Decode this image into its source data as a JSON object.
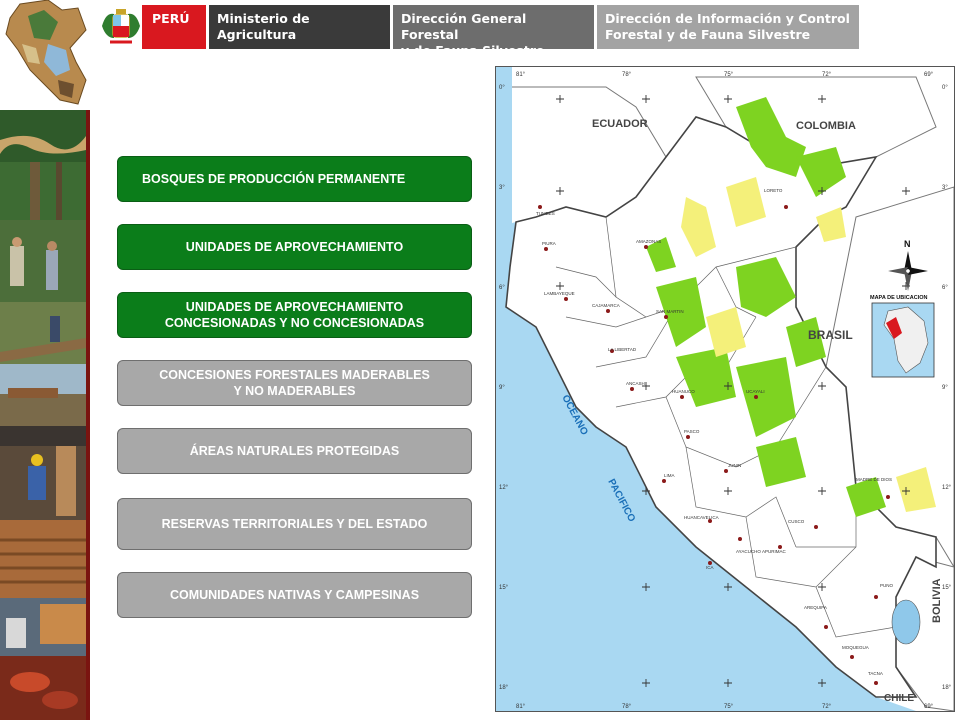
{
  "header": {
    "country": "PERÚ",
    "ministry": "Ministerio de\nAgricultura",
    "directorate": "Dirección General Forestal\ny de Fauna Silvestre",
    "office": "Dirección de Información y Control\nForestal y de Fauna Silvestre"
  },
  "colors": {
    "peru_red": "#d9181f",
    "button_green": "#0b7d1a",
    "button_gray": "#a8a8a8",
    "sea_blue": "#a9d8f2",
    "forest_green": "#7ed321",
    "forest_yellow": "#f4f07a"
  },
  "menu": [
    {
      "label": "BOSQUES DE PRODUCCIÓN PERMANENTE",
      "style": "green"
    },
    {
      "label": "UNIDADES DE APROVECHAMIENTO",
      "style": "green"
    },
    {
      "label": "UNIDADES DE APROVECHAMIENTO CONCESIONADAS Y NO CONCESIONADAS",
      "style": "green"
    },
    {
      "label": "CONCESIONES FORESTALES MADERABLES Y NO MADERABLES",
      "style": "gray"
    },
    {
      "label": "ÁREAS NATURALES PROTEGIDAS",
      "style": "gray"
    },
    {
      "label": "RESERVAS TERRITORIALES Y DEL ESTADO",
      "style": "gray"
    },
    {
      "label": "COMUNIDADES NATIVAS Y CAMPESINAS",
      "style": "gray"
    }
  ],
  "map": {
    "countries": {
      "ecuador": "ECUADOR",
      "colombia": "COLOMBIA",
      "brasil": "BRASIL",
      "bolivia": "BOLIVIA",
      "chile": "CHILE"
    },
    "ocean": [
      "OCEANO",
      "PACIFICO"
    ],
    "inset_title": "MAPA DE UBICACION",
    "north": "N",
    "lon_ticks": [
      "81°",
      "78°",
      "75°",
      "72°",
      "69°"
    ],
    "lat_ticks": [
      "0°",
      "3°",
      "6°",
      "9°",
      "12°",
      "15°",
      "18°"
    ],
    "cities": [
      "TUMBES",
      "PIURA",
      "LAMBAYEQUE",
      "CAJAMARCA",
      "AMAZONAS",
      "LORETO",
      "SAN MARTIN",
      "LA LIBERTAD",
      "ANCASH",
      "HUANUCO",
      "UCAYALI",
      "PASCO",
      "LIMA",
      "JUNIN",
      "HUANCAVELICA",
      "ICA",
      "AYACUCHO",
      "APURIMAC",
      "CUSCO",
      "MADRE DE DIOS",
      "PUNO",
      "AREQUIPA",
      "MOQUEGUA",
      "TACNA"
    ]
  }
}
